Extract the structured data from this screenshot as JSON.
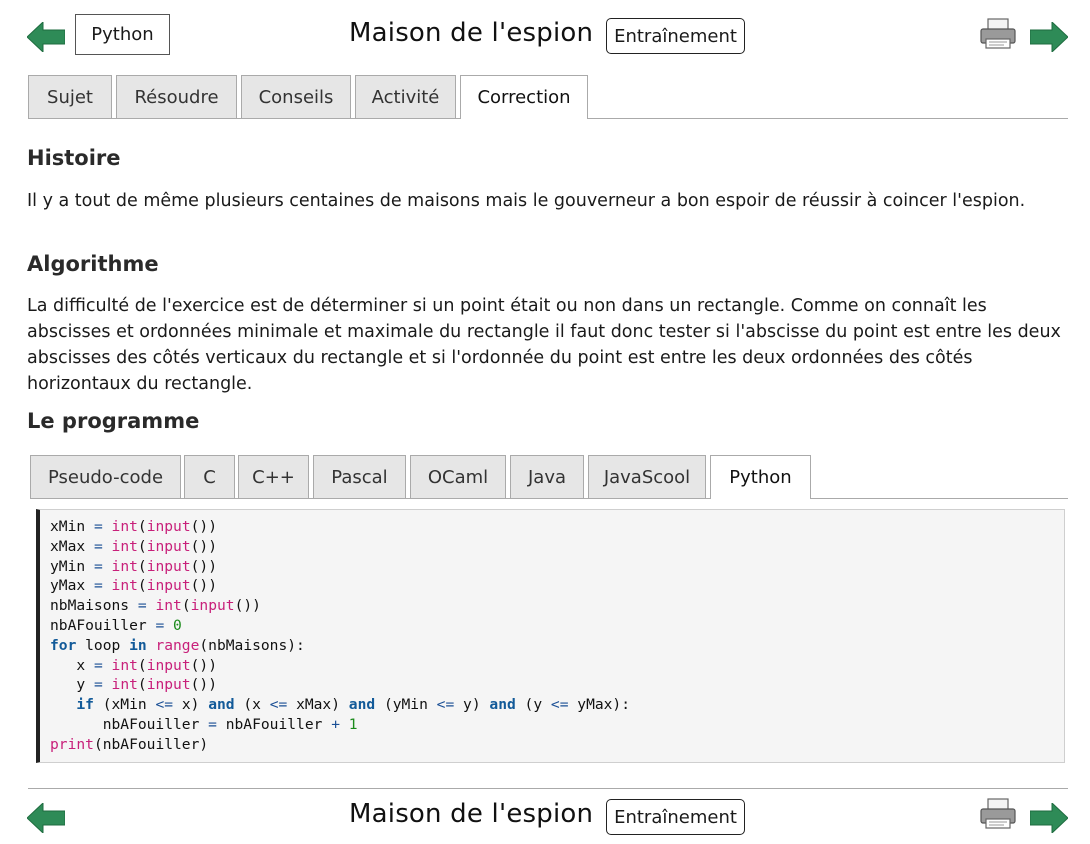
{
  "header": {
    "language_button": "Python",
    "title": "Maison de l'espion",
    "training_button": "Entraînement"
  },
  "tabs": [
    {
      "label": "Sujet",
      "active": false
    },
    {
      "label": "Résoudre",
      "active": false
    },
    {
      "label": "Conseils",
      "active": false
    },
    {
      "label": "Activité",
      "active": false
    },
    {
      "label": "Correction",
      "active": true
    }
  ],
  "sections": {
    "histoire": {
      "heading": "Histoire",
      "text": "Il y a tout de même plusieurs centaines de maisons mais le gouverneur a bon espoir de réussir à coincer l'espion."
    },
    "algorithme": {
      "heading": "Algorithme",
      "text": "La difficulté de l'exercice est de déterminer si un point était ou non dans un rectangle. Comme on connaît les abscisses et ordonnées minimale et maximale du rectangle il faut donc tester si l'abscisse du point est entre les deux abscisses des côtés verticaux du rectangle et si l'ordonnée du point est entre les deux ordonnées des côtés horizontaux du rectangle."
    },
    "programme": {
      "heading": "Le programme"
    }
  },
  "language_tabs": [
    {
      "label": "Pseudo-code",
      "active": false
    },
    {
      "label": "C",
      "active": false
    },
    {
      "label": "C++",
      "active": false
    },
    {
      "label": "Pascal",
      "active": false
    },
    {
      "label": "OCaml",
      "active": false
    },
    {
      "label": "Java",
      "active": false
    },
    {
      "label": "JavaScool",
      "active": false
    },
    {
      "label": "Python",
      "active": true
    }
  ],
  "code_lines": [
    [
      [
        "t",
        "xMin "
      ],
      [
        "op",
        "="
      ],
      [
        "t",
        " "
      ],
      [
        "fn",
        "int"
      ],
      [
        "t",
        "("
      ],
      [
        "fn",
        "input"
      ],
      [
        "t",
        "())"
      ]
    ],
    [
      [
        "t",
        "xMax "
      ],
      [
        "op",
        "="
      ],
      [
        "t",
        " "
      ],
      [
        "fn",
        "int"
      ],
      [
        "t",
        "("
      ],
      [
        "fn",
        "input"
      ],
      [
        "t",
        "())"
      ]
    ],
    [
      [
        "t",
        "yMin "
      ],
      [
        "op",
        "="
      ],
      [
        "t",
        " "
      ],
      [
        "fn",
        "int"
      ],
      [
        "t",
        "("
      ],
      [
        "fn",
        "input"
      ],
      [
        "t",
        "())"
      ]
    ],
    [
      [
        "t",
        "yMax "
      ],
      [
        "op",
        "="
      ],
      [
        "t",
        " "
      ],
      [
        "fn",
        "int"
      ],
      [
        "t",
        "("
      ],
      [
        "fn",
        "input"
      ],
      [
        "t",
        "())"
      ]
    ],
    [
      [
        "t",
        "nbMaisons "
      ],
      [
        "op",
        "="
      ],
      [
        "t",
        " "
      ],
      [
        "fn",
        "int"
      ],
      [
        "t",
        "("
      ],
      [
        "fn",
        "input"
      ],
      [
        "t",
        "())"
      ]
    ],
    [
      [
        "t",
        "nbAFouiller "
      ],
      [
        "op",
        "="
      ],
      [
        "t",
        " "
      ],
      [
        "num",
        "0"
      ]
    ],
    [
      [
        "kw",
        "for"
      ],
      [
        "t",
        " loop "
      ],
      [
        "kw",
        "in"
      ],
      [
        "t",
        " "
      ],
      [
        "fn",
        "range"
      ],
      [
        "t",
        "(nbMaisons):"
      ]
    ],
    [
      [
        "t",
        "   x "
      ],
      [
        "op",
        "="
      ],
      [
        "t",
        " "
      ],
      [
        "fn",
        "int"
      ],
      [
        "t",
        "("
      ],
      [
        "fn",
        "input"
      ],
      [
        "t",
        "())"
      ]
    ],
    [
      [
        "t",
        "   y "
      ],
      [
        "op",
        "="
      ],
      [
        "t",
        " "
      ],
      [
        "fn",
        "int"
      ],
      [
        "t",
        "("
      ],
      [
        "fn",
        "input"
      ],
      [
        "t",
        "())"
      ]
    ],
    [
      [
        "t",
        "   "
      ],
      [
        "kw",
        "if"
      ],
      [
        "t",
        " (xMin "
      ],
      [
        "op",
        "<="
      ],
      [
        "t",
        " x) "
      ],
      [
        "kw",
        "and"
      ],
      [
        "t",
        " (x "
      ],
      [
        "op",
        "<="
      ],
      [
        "t",
        " xMax) "
      ],
      [
        "kw",
        "and"
      ],
      [
        "t",
        " (yMin "
      ],
      [
        "op",
        "<="
      ],
      [
        "t",
        " y) "
      ],
      [
        "kw",
        "and"
      ],
      [
        "t",
        " (y "
      ],
      [
        "op",
        "<="
      ],
      [
        "t",
        " yMax):"
      ]
    ],
    [
      [
        "t",
        "      nbAFouiller "
      ],
      [
        "op",
        "="
      ],
      [
        "t",
        " nbAFouiller "
      ],
      [
        "op",
        "+"
      ],
      [
        "t",
        " "
      ],
      [
        "num",
        "1"
      ]
    ],
    [
      [
        "fn",
        "print"
      ],
      [
        "t",
        "(nbAFouiller)"
      ]
    ]
  ],
  "footer": {
    "title": "Maison de l'espion",
    "training_button": "Entraînement"
  },
  "icons": {
    "arrow_color": "#2e8b57",
    "printer": "printer-icon"
  }
}
